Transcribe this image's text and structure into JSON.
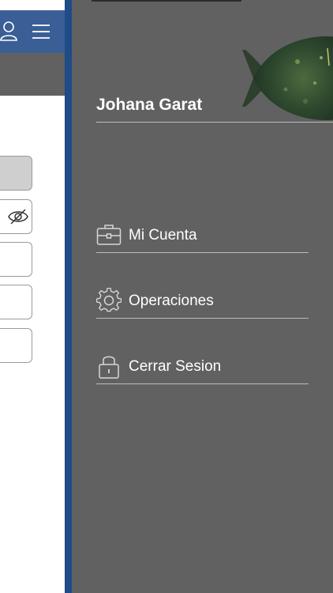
{
  "drawer": {
    "user_name": "Johana Garat",
    "items": [
      {
        "label": "Mi Cuenta",
        "icon": "briefcase-icon"
      },
      {
        "label": "Operaciones",
        "icon": "gear-icon"
      },
      {
        "label": "Cerrar Sesion",
        "icon": "lock-icon"
      }
    ]
  },
  "colors": {
    "drawer_bg": "#616161",
    "drawer_edge": "#1f4b86",
    "header_bg": "#3a5f96",
    "text": "#ffffff"
  }
}
